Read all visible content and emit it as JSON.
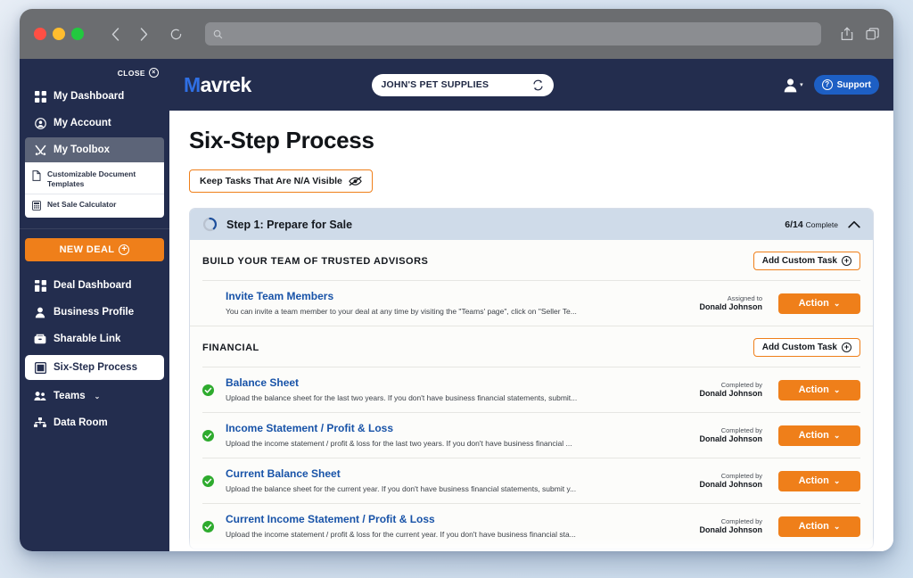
{
  "browser": {
    "traffic_lights": [
      "close-red",
      "minimize-yellow",
      "maximize-green"
    ],
    "back_icon": "‹",
    "forward_icon": "›",
    "reload_icon": "⟳",
    "address_placeholder": "",
    "search_icon": "search-icon",
    "share_icon": "share-icon",
    "tabs_icon": "tabs-icon"
  },
  "sidebar": {
    "close_label": "CLOSE",
    "close_icon": "×",
    "items": [
      {
        "label": "My Dashboard",
        "icon": "dashboard-grid-icon"
      },
      {
        "label": "My Account",
        "icon": "account-circle-icon"
      },
      {
        "label": "My Toolbox",
        "icon": "tools-icon"
      }
    ],
    "toolbox_submenu": [
      {
        "label": "Customizable Document Templates",
        "icon": "document-icon"
      },
      {
        "label": "Net Sale Calculator",
        "icon": "calculator-icon"
      }
    ],
    "new_deal": {
      "label": "NEW DEAL",
      "icon": "plus-circle-icon"
    },
    "deal_items": [
      {
        "label": "Deal Dashboard",
        "icon": "dashboard-grid-icon",
        "active": false
      },
      {
        "label": "Business Profile",
        "icon": "person-icon",
        "active": false
      },
      {
        "label": "Sharable Link",
        "icon": "link-card-icon",
        "active": false
      },
      {
        "label": "Six-Step Process",
        "icon": "window-icon",
        "active": true
      },
      {
        "label": "Teams",
        "icon": "people-icon",
        "active": false,
        "chevron": "⌄"
      },
      {
        "label": "Data Room",
        "icon": "sitemap-icon",
        "active": false
      }
    ]
  },
  "topbar": {
    "logo_first": "M",
    "logo_rest": "avrek",
    "company": "JOHN'S PET SUPPLIES",
    "company_switch_icon": "swap-icon",
    "avatar_icon": "user-icon",
    "avatar_chevron": "▾",
    "support_label": "Support",
    "support_icon": "question-circle-icon"
  },
  "page": {
    "title": "Six-Step Process",
    "na_toggle_label": "Keep Tasks That Are N/A Visible",
    "na_toggle_icon": "eye-slash-icon"
  },
  "step": {
    "title": "Step 1: Prepare for Sale",
    "progress_icon": "progress-ring-icon",
    "completed": 6,
    "total": 14,
    "count_label": "6/14",
    "complete_label": "Complete",
    "collapse_icon": "⌃",
    "progress_percent": 43
  },
  "sections": [
    {
      "title": "BUILD YOUR TEAM OF TRUSTED ADVISORS",
      "add_task_label": "Add Custom Task",
      "add_task_icon": "plus-circle-icon",
      "tasks": [
        {
          "title": "Invite Team Members",
          "desc": "You can invite a team member to your deal at any time by visiting the \"Teams' page\", click on \"Seller Te...",
          "status": "none",
          "assign_label": "Assigned to",
          "assign_who": "Donald Johnson",
          "action_label": "Action",
          "action_chevron": "⌄"
        }
      ]
    },
    {
      "title": "FINANCIAL",
      "add_task_label": "Add Custom Task",
      "add_task_icon": "plus-circle-icon",
      "tasks": [
        {
          "title": "Balance Sheet",
          "desc": "Upload the balance sheet for the last two years. If you don't have business financial statements, submit...",
          "status": "complete",
          "assign_label": "Completed by",
          "assign_who": "Donald Johnson",
          "action_label": "Action",
          "action_chevron": "⌄"
        },
        {
          "title": "Income Statement / Profit & Loss",
          "desc": "Upload the income statement / profit & loss for the last two years. If you don't have business financial ...",
          "status": "complete",
          "assign_label": "Completed by",
          "assign_who": "Donald Johnson",
          "action_label": "Action",
          "action_chevron": "⌄"
        },
        {
          "title": "Current Balance Sheet",
          "desc": "Upload the balance sheet for the current year. If you don't have business financial statements, submit y...",
          "status": "complete",
          "assign_label": "Completed by",
          "assign_who": "Donald Johnson",
          "action_label": "Action",
          "action_chevron": "⌄"
        },
        {
          "title": "Current Income Statement / Profit & Loss",
          "desc": "Upload the income statement / profit & loss for the current year. If you don't have business financial sta...",
          "status": "complete",
          "assign_label": "Completed by",
          "assign_who": "Donald Johnson",
          "action_label": "Action",
          "action_chevron": "⌄"
        }
      ]
    }
  ],
  "colors": {
    "sidebar_bg": "#232d4e",
    "accent_orange": "#ef7f1a",
    "link_blue": "#1853a8",
    "logo_blue": "#2f6fe4",
    "support_blue": "#1d5fc4",
    "step_header_bg": "#cfdbe9",
    "complete_green": "#2eab2e",
    "toolbox_active": "#5c6478"
  }
}
